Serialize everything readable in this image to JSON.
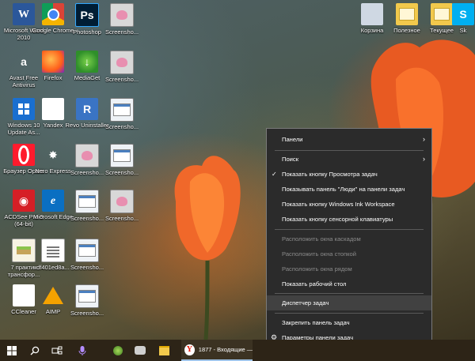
{
  "desktop": {
    "icons": [
      {
        "label": "Microsoft Word 2010",
        "icon": "word-icon"
      },
      {
        "label": "Google Chrome",
        "icon": "chrome-icon"
      },
      {
        "label": "Photoshop",
        "icon": "photoshop-icon"
      },
      {
        "label": "Screensho...",
        "icon": "screenshot-icon"
      },
      {
        "label": "Avast Free Antivirus",
        "icon": "avast-icon"
      },
      {
        "label": "Firefox",
        "icon": "firefox-icon"
      },
      {
        "label": "MediaGet",
        "icon": "mediaget-icon"
      },
      {
        "label": "Screensho...",
        "icon": "screenshot-icon"
      },
      {
        "label": "Windows 10 Update As...",
        "icon": "windows-update-icon"
      },
      {
        "label": "Yandex",
        "icon": "yandex-icon"
      },
      {
        "label": "Revo Uninstaller",
        "icon": "revo-icon"
      },
      {
        "label": "Screensho...",
        "icon": "screenshot-icon"
      },
      {
        "label": "Браузер Opera",
        "icon": "opera-icon"
      },
      {
        "label": "Nero Express",
        "icon": "nero-icon"
      },
      {
        "label": "Screensho...",
        "icon": "screenshot-icon"
      },
      {
        "label": "Screensho...",
        "icon": "screenshot-icon"
      },
      {
        "label": "ACDSee Pro 9 (64-bit)",
        "icon": "acdsee-icon"
      },
      {
        "label": "Microsoft Edge",
        "icon": "edge-icon"
      },
      {
        "label": "Screensho...",
        "icon": "screenshot-icon"
      },
      {
        "label": "Screensho...",
        "icon": "screenshot-icon"
      },
      {
        "label": "7 практик трансфор...",
        "icon": "document-icon"
      },
      {
        "label": "df401ed8a...",
        "icon": "file-icon"
      },
      {
        "label": "Screensho...",
        "icon": "screenshot-icon"
      },
      {
        "label": "CCleaner",
        "icon": "ccleaner-icon"
      },
      {
        "label": "AIMP",
        "icon": "aimp-icon"
      },
      {
        "label": "Screensho...",
        "icon": "screenshot-icon"
      },
      {
        "label": "Корзина",
        "icon": "recycle-bin-icon"
      },
      {
        "label": "Полезное",
        "icon": "folder-icon"
      },
      {
        "label": "Текущее",
        "icon": "folder-icon"
      },
      {
        "label": "Sk",
        "icon": "skype-icon"
      }
    ]
  },
  "context_menu": {
    "panels": "Панели",
    "search": "Поиск",
    "show_task_view": "Показать кнопку Просмотра задач",
    "show_people": "Показывать панель \"Люди\" на панели задач",
    "show_ink": "Показать кнопку Windows Ink Workspace",
    "show_keyboard": "Показать кнопку сенсорной клавиатуры",
    "cascade": "Расположить окна каскадом",
    "stack": "Расположить окна стопкой",
    "side_by_side": "Расположить окна рядом",
    "show_desktop": "Показать рабочий стол",
    "task_manager": "Диспетчер задач",
    "lock_taskbar": "Закрепить панель задач",
    "taskbar_settings": "Параметры панели задач"
  },
  "taskbar": {
    "active_app_title": "1877 - Входящие —...",
    "icons": [
      "windows-start-icon",
      "search-icon",
      "task-view-icon",
      "cortana-icon",
      "app-icon",
      "app-icon",
      "file-explorer-icon",
      "yandex-icon"
    ]
  },
  "colors": {
    "menu_bg": "#2b2b2b",
    "menu_hover": "#414141",
    "taskbar_bg": "#2d2417",
    "accent_underline": "#9fc3e8"
  }
}
